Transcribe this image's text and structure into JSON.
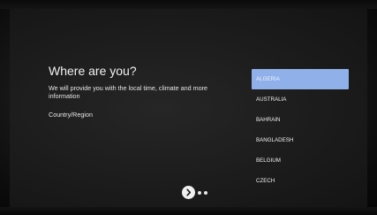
{
  "setup": {
    "title": "Where are you?",
    "description": "We will provide you with the local time, climate and more information",
    "field_label": "Country/Region"
  },
  "country_list": {
    "items": [
      {
        "label": "ALGERIA",
        "selected": true
      },
      {
        "label": "AUSTRALIA",
        "selected": false
      },
      {
        "label": "BAHRAIN",
        "selected": false
      },
      {
        "label": "BANGLADESH",
        "selected": false
      },
      {
        "label": "BELGIUM",
        "selected": false
      },
      {
        "label": "CZECH",
        "selected": false
      }
    ],
    "highlight_color": "#8fb0e8"
  },
  "pager": {
    "next_icon": "chevron-right-icon",
    "dots": 2
  }
}
